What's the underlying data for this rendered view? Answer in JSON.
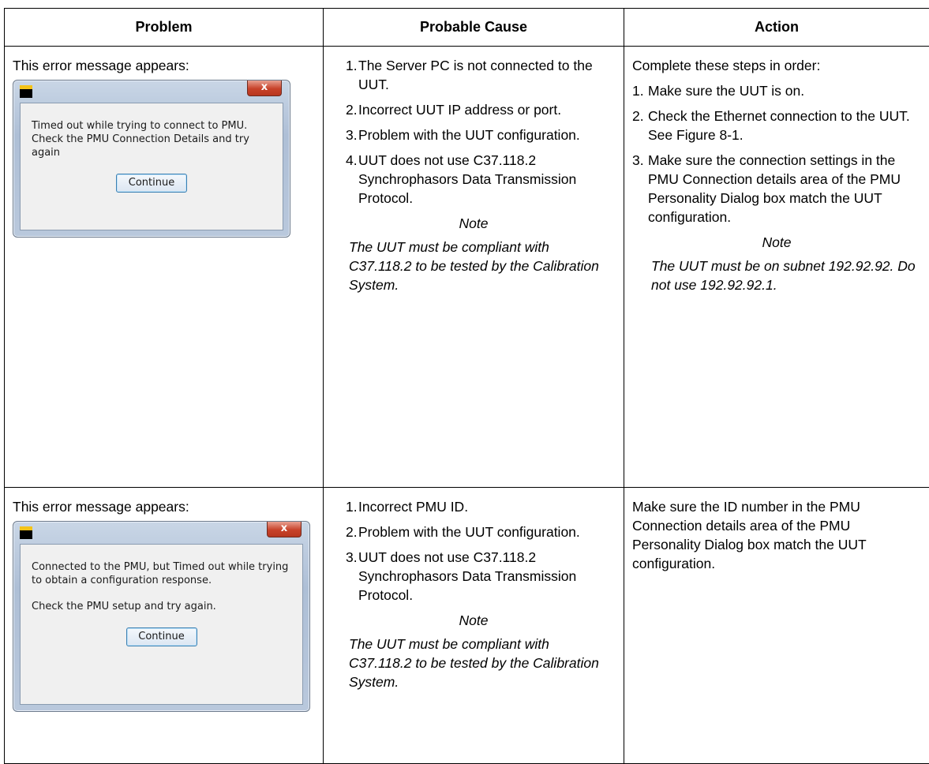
{
  "headers": {
    "problem": "Problem",
    "cause": "Probable Cause",
    "action": "Action"
  },
  "rows": [
    {
      "problem_text": "This error message appears:",
      "dialog": {
        "close_glyph": "x",
        "message": "Timed out while trying to connect to PMU. Check the PMU Connection Details and try again",
        "button": "Continue"
      },
      "causes": [
        {
          "num": "1.",
          "text": "The Server PC is not connected to the UUT."
        },
        {
          "num": "2.",
          "text": "Incorrect UUT IP address or port."
        },
        {
          "num": "3.",
          "text": "Problem with the UUT configuration."
        },
        {
          "num": "4.",
          "text": "UUT does not use C37.118.2 Synchrophasors Data Transmission Protocol."
        }
      ],
      "cause_note_head": "Note",
      "cause_note": "The UUT must be compliant with C37.118.2 to be tested by the Calibration System.",
      "action_intro": "Complete these steps in order:",
      "actions": [
        {
          "num": "1.",
          "text": "Make sure the UUT is on."
        },
        {
          "num": "2.",
          "text": "Check the Ethernet connection to the UUT. See Figure 8-1."
        },
        {
          "num": "3.",
          "text": "Make sure the connection settings in the PMU Connection details area of the PMU Personality Dialog box match the UUT configuration."
        }
      ],
      "action_note_head": "Note",
      "action_note": "The UUT must be on subnet 192.92.92. Do not use 192.92.92.1."
    },
    {
      "problem_text": "This error message appears:",
      "dialog": {
        "close_glyph": "x",
        "message": "Connected to the PMU, but Timed out while trying to obtain a configuration response.",
        "message2": "Check the PMU setup and try again.",
        "button": "Continue"
      },
      "causes": [
        {
          "num": "1.",
          "text": "Incorrect PMU ID."
        },
        {
          "num": "2.",
          "text": "Problem with the UUT configuration."
        },
        {
          "num": "3.",
          "text": "UUT does not use C37.118.2 Synchrophasors Data Transmission Protocol."
        }
      ],
      "cause_note_head": "Note",
      "cause_note": "The UUT must be compliant with C37.118.2 to be tested by the Calibration System.",
      "action_text": "Make sure the ID number in the PMU Connection details area of the PMU Personality Dialog box match the UUT configuration."
    }
  ]
}
